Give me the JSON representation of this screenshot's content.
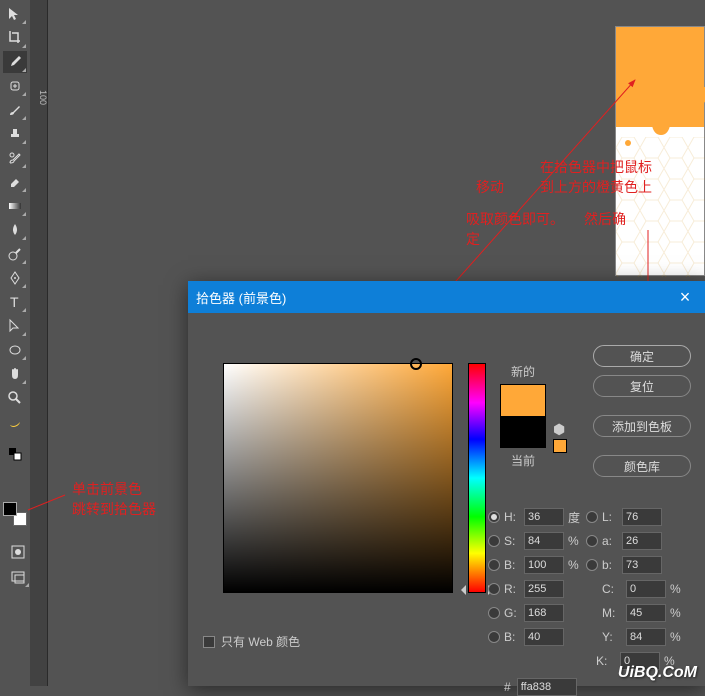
{
  "toolbar": {
    "tools": [
      "move",
      "crop-icon",
      "eyedropper-icon",
      "healing-icon",
      "brush-icon",
      "stamp-icon",
      "history-brush-icon",
      "eraser-icon",
      "gradient-icon",
      "blur-icon",
      "dodge-icon",
      "pen-icon",
      "type-icon",
      "path-select-icon",
      "rectangle-icon",
      "hand-icon",
      "zoom-icon",
      "banana-icon"
    ]
  },
  "ruler": {
    "t100": "100"
  },
  "annotations": {
    "move": "移动",
    "pick_hint_1": "在拾色器中把鼠标",
    "pick_hint_2": "到上方的橙黄色上",
    "eyedrop": "吸取颜色即可。",
    "confirm": "然后确",
    "ding": "定",
    "fg_click_1": "单击前景色",
    "fg_click_2": "跳转到拾色器"
  },
  "dialog": {
    "title": "拾色器 (前景色)",
    "new_label": "新的",
    "current_label": "当前",
    "btn_ok": "确定",
    "btn_reset": "复位",
    "btn_add_swatch": "添加到色板",
    "btn_color_lib": "颜色库",
    "web_only": "只有 Web 颜色",
    "hex_prefix": "#",
    "hex": "ffa838",
    "h": {
      "label": "H:",
      "val": "36",
      "unit": "度"
    },
    "s": {
      "label": "S:",
      "val": "84",
      "unit": "%"
    },
    "bb": {
      "label": "B:",
      "val": "100",
      "unit": "%"
    },
    "r": {
      "label": "R:",
      "val": "255"
    },
    "g": {
      "label": "G:",
      "val": "168"
    },
    "b": {
      "label": "B:",
      "val": "40"
    },
    "l": {
      "label": "L:",
      "val": "76"
    },
    "a": {
      "label": "a:",
      "val": "26"
    },
    "lb": {
      "label": "b:",
      "val": "73"
    },
    "c": {
      "label": "C:",
      "val": "0",
      "unit": "%"
    },
    "m": {
      "label": "M:",
      "val": "45",
      "unit": "%"
    },
    "y": {
      "label": "Y:",
      "val": "84",
      "unit": "%"
    },
    "k": {
      "label": "K:",
      "val": "0",
      "unit": "%"
    }
  },
  "watermark": "UiBQ.CoM"
}
